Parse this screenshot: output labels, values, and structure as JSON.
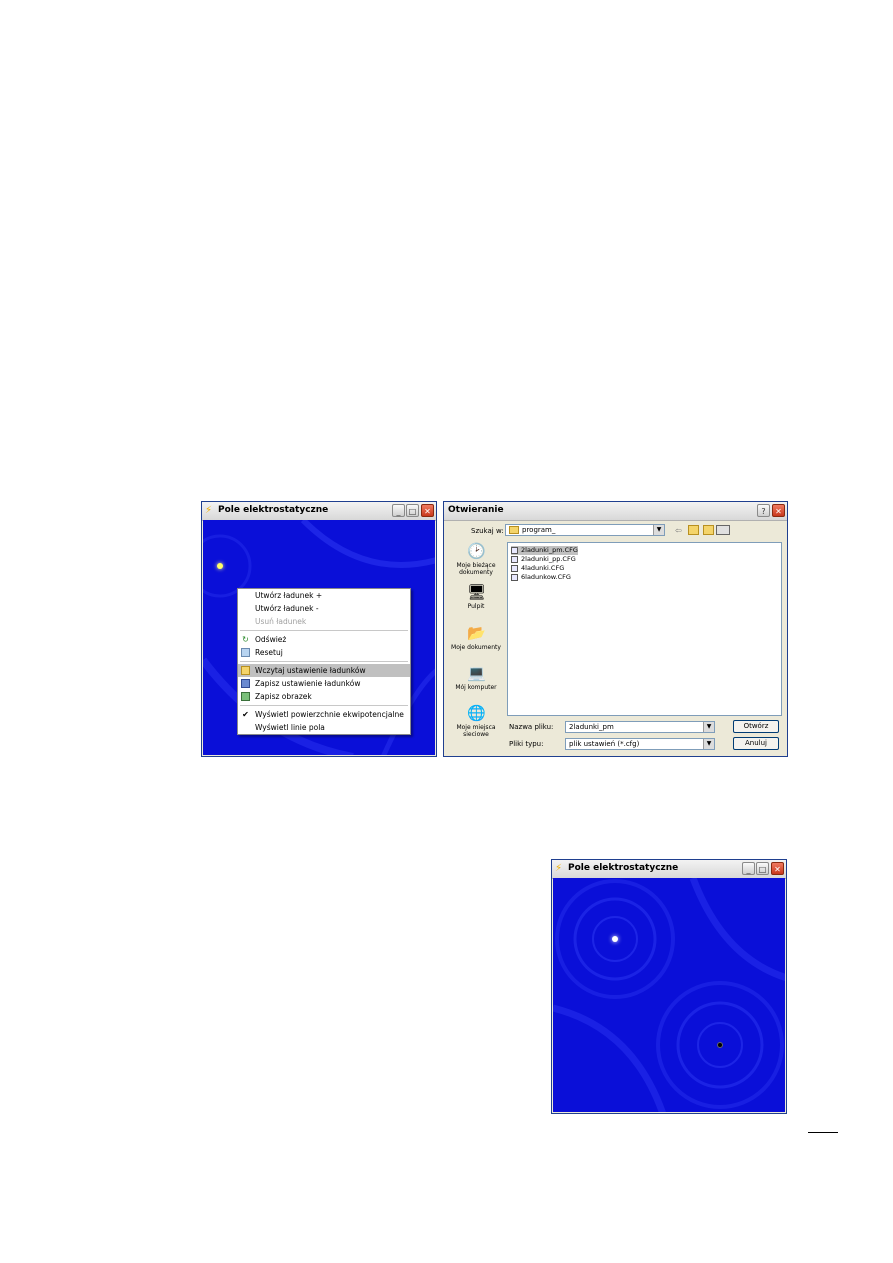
{
  "window1": {
    "title": "Pole elektrostatyczne",
    "context_menu": {
      "items": [
        {
          "label": "Utwórz ładunek +",
          "icon": "",
          "state": "normal"
        },
        {
          "label": "Utwórz ładunek -",
          "icon": "",
          "state": "normal"
        },
        {
          "label": "Usuń ładunek",
          "icon": "",
          "state": "disabled"
        },
        {
          "label": "Odśwież",
          "icon": "refresh-icon",
          "state": "normal"
        },
        {
          "label": "Resetuj",
          "icon": "reset-icon",
          "state": "normal"
        },
        {
          "label": "Wczytaj ustawienie ładunków",
          "icon": "folder-icon",
          "state": "selected"
        },
        {
          "label": "Zapisz ustawienie ładunków",
          "icon": "save-icon",
          "state": "normal"
        },
        {
          "label": "Zapisz obrazek",
          "icon": "image-icon",
          "state": "normal"
        },
        {
          "label": "Wyświetl powierzchnie ekwipotencjalne",
          "icon": "check-icon",
          "state": "checked"
        },
        {
          "label": "Wyświetl linie pola",
          "icon": "",
          "state": "normal"
        }
      ]
    }
  },
  "open_dialog": {
    "title": "Otwieranie",
    "look_in_label": "Szukaj w:",
    "look_in_value": "program_",
    "places": [
      "Moje bieżące dokumenty",
      "Pulpit",
      "Moje dokumenty",
      "Mój komputer",
      "Moje miejsca sieciowe"
    ],
    "files": [
      "2ladunki_pm.CFG",
      "2ladunki_pp.CFG",
      "4ladunki.CFG",
      "6ladunkow.CFG"
    ],
    "filename_label": "Nazwa pliku:",
    "filename_value": "2ladunki_pm",
    "filetype_label": "Pliki typu:",
    "filetype_value": "plik ustawień (*.cfg)",
    "open_button": "Otwórz",
    "cancel_button": "Anuluj"
  },
  "window2": {
    "title": "Pole elektrostatyczne"
  },
  "colors": {
    "field_background": "#0a0fd8",
    "positive_charge": "#ffffff",
    "negative_charge": "#000000"
  }
}
